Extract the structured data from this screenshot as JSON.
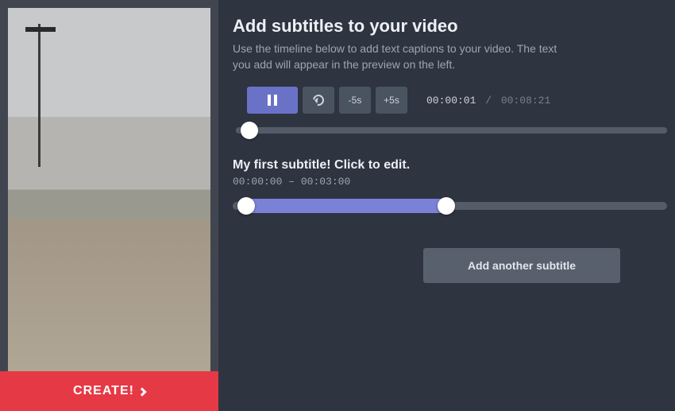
{
  "header": {
    "title": "Add subtitles to your video",
    "description": "Use the timeline below to add text captions to your video. The text you add will appear in the preview on the left."
  },
  "controls": {
    "back5": "-5s",
    "fwd5": "+5s",
    "current_time": "00:00:01",
    "separator": "/",
    "total_time": "00:08:21"
  },
  "subtitle": {
    "text": "My first subtitle! Click to edit.",
    "start": "00:00:00",
    "dash": "–",
    "end": "00:03:00"
  },
  "actions": {
    "add_another": "Add another subtitle",
    "create": "CREATE!"
  }
}
